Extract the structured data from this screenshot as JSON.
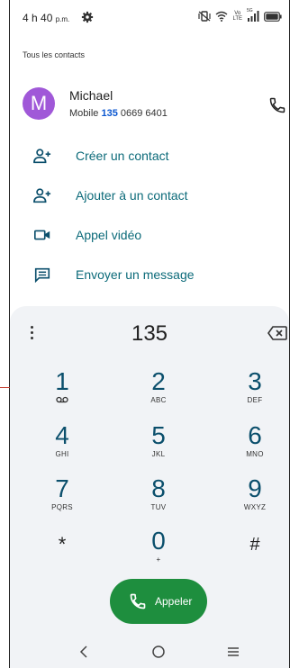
{
  "status_bar": {
    "time": "4 h 40",
    "time_suffix": "p.m.",
    "icons": [
      "gear-icon",
      "vibrate-icon",
      "wifi-icon",
      "volte-icon",
      "signal-icon",
      "battery-icon"
    ],
    "volte_top": "Vo",
    "volte_bottom": "LTE",
    "net": "5G"
  },
  "section_title": "Tous les contacts",
  "contact": {
    "avatar_letter": "M",
    "name": "Michael",
    "type": "Mobile",
    "match": "135",
    "number_rest": "0669 6401",
    "avatar_color": "#a058d8"
  },
  "actions": [
    {
      "label": "Créer un contact",
      "icon": "person-add-icon"
    },
    {
      "label": "Ajouter à un contact",
      "icon": "person-add-icon"
    },
    {
      "label": "Appel vidéo",
      "icon": "video-icon"
    },
    {
      "label": "Envoyer un message",
      "icon": "message-icon"
    }
  ],
  "dialpad": {
    "entered": "135",
    "keys": [
      {
        "num": "1",
        "letters": ""
      },
      {
        "num": "2",
        "letters": "ABC"
      },
      {
        "num": "3",
        "letters": "DEF"
      },
      {
        "num": "4",
        "letters": "GHI"
      },
      {
        "num": "5",
        "letters": "JKL"
      },
      {
        "num": "6",
        "letters": "MNO"
      },
      {
        "num": "7",
        "letters": "PQRS"
      },
      {
        "num": "8",
        "letters": "TUV"
      },
      {
        "num": "9",
        "letters": "WXYZ"
      },
      {
        "num": "*",
        "letters": ""
      },
      {
        "num": "0",
        "letters": "+"
      },
      {
        "num": "#",
        "letters": ""
      }
    ]
  },
  "call_button": {
    "label": "Appeler",
    "color": "#1e8e3e"
  },
  "nav": [
    "back-icon",
    "home-icon",
    "recents-icon"
  ]
}
